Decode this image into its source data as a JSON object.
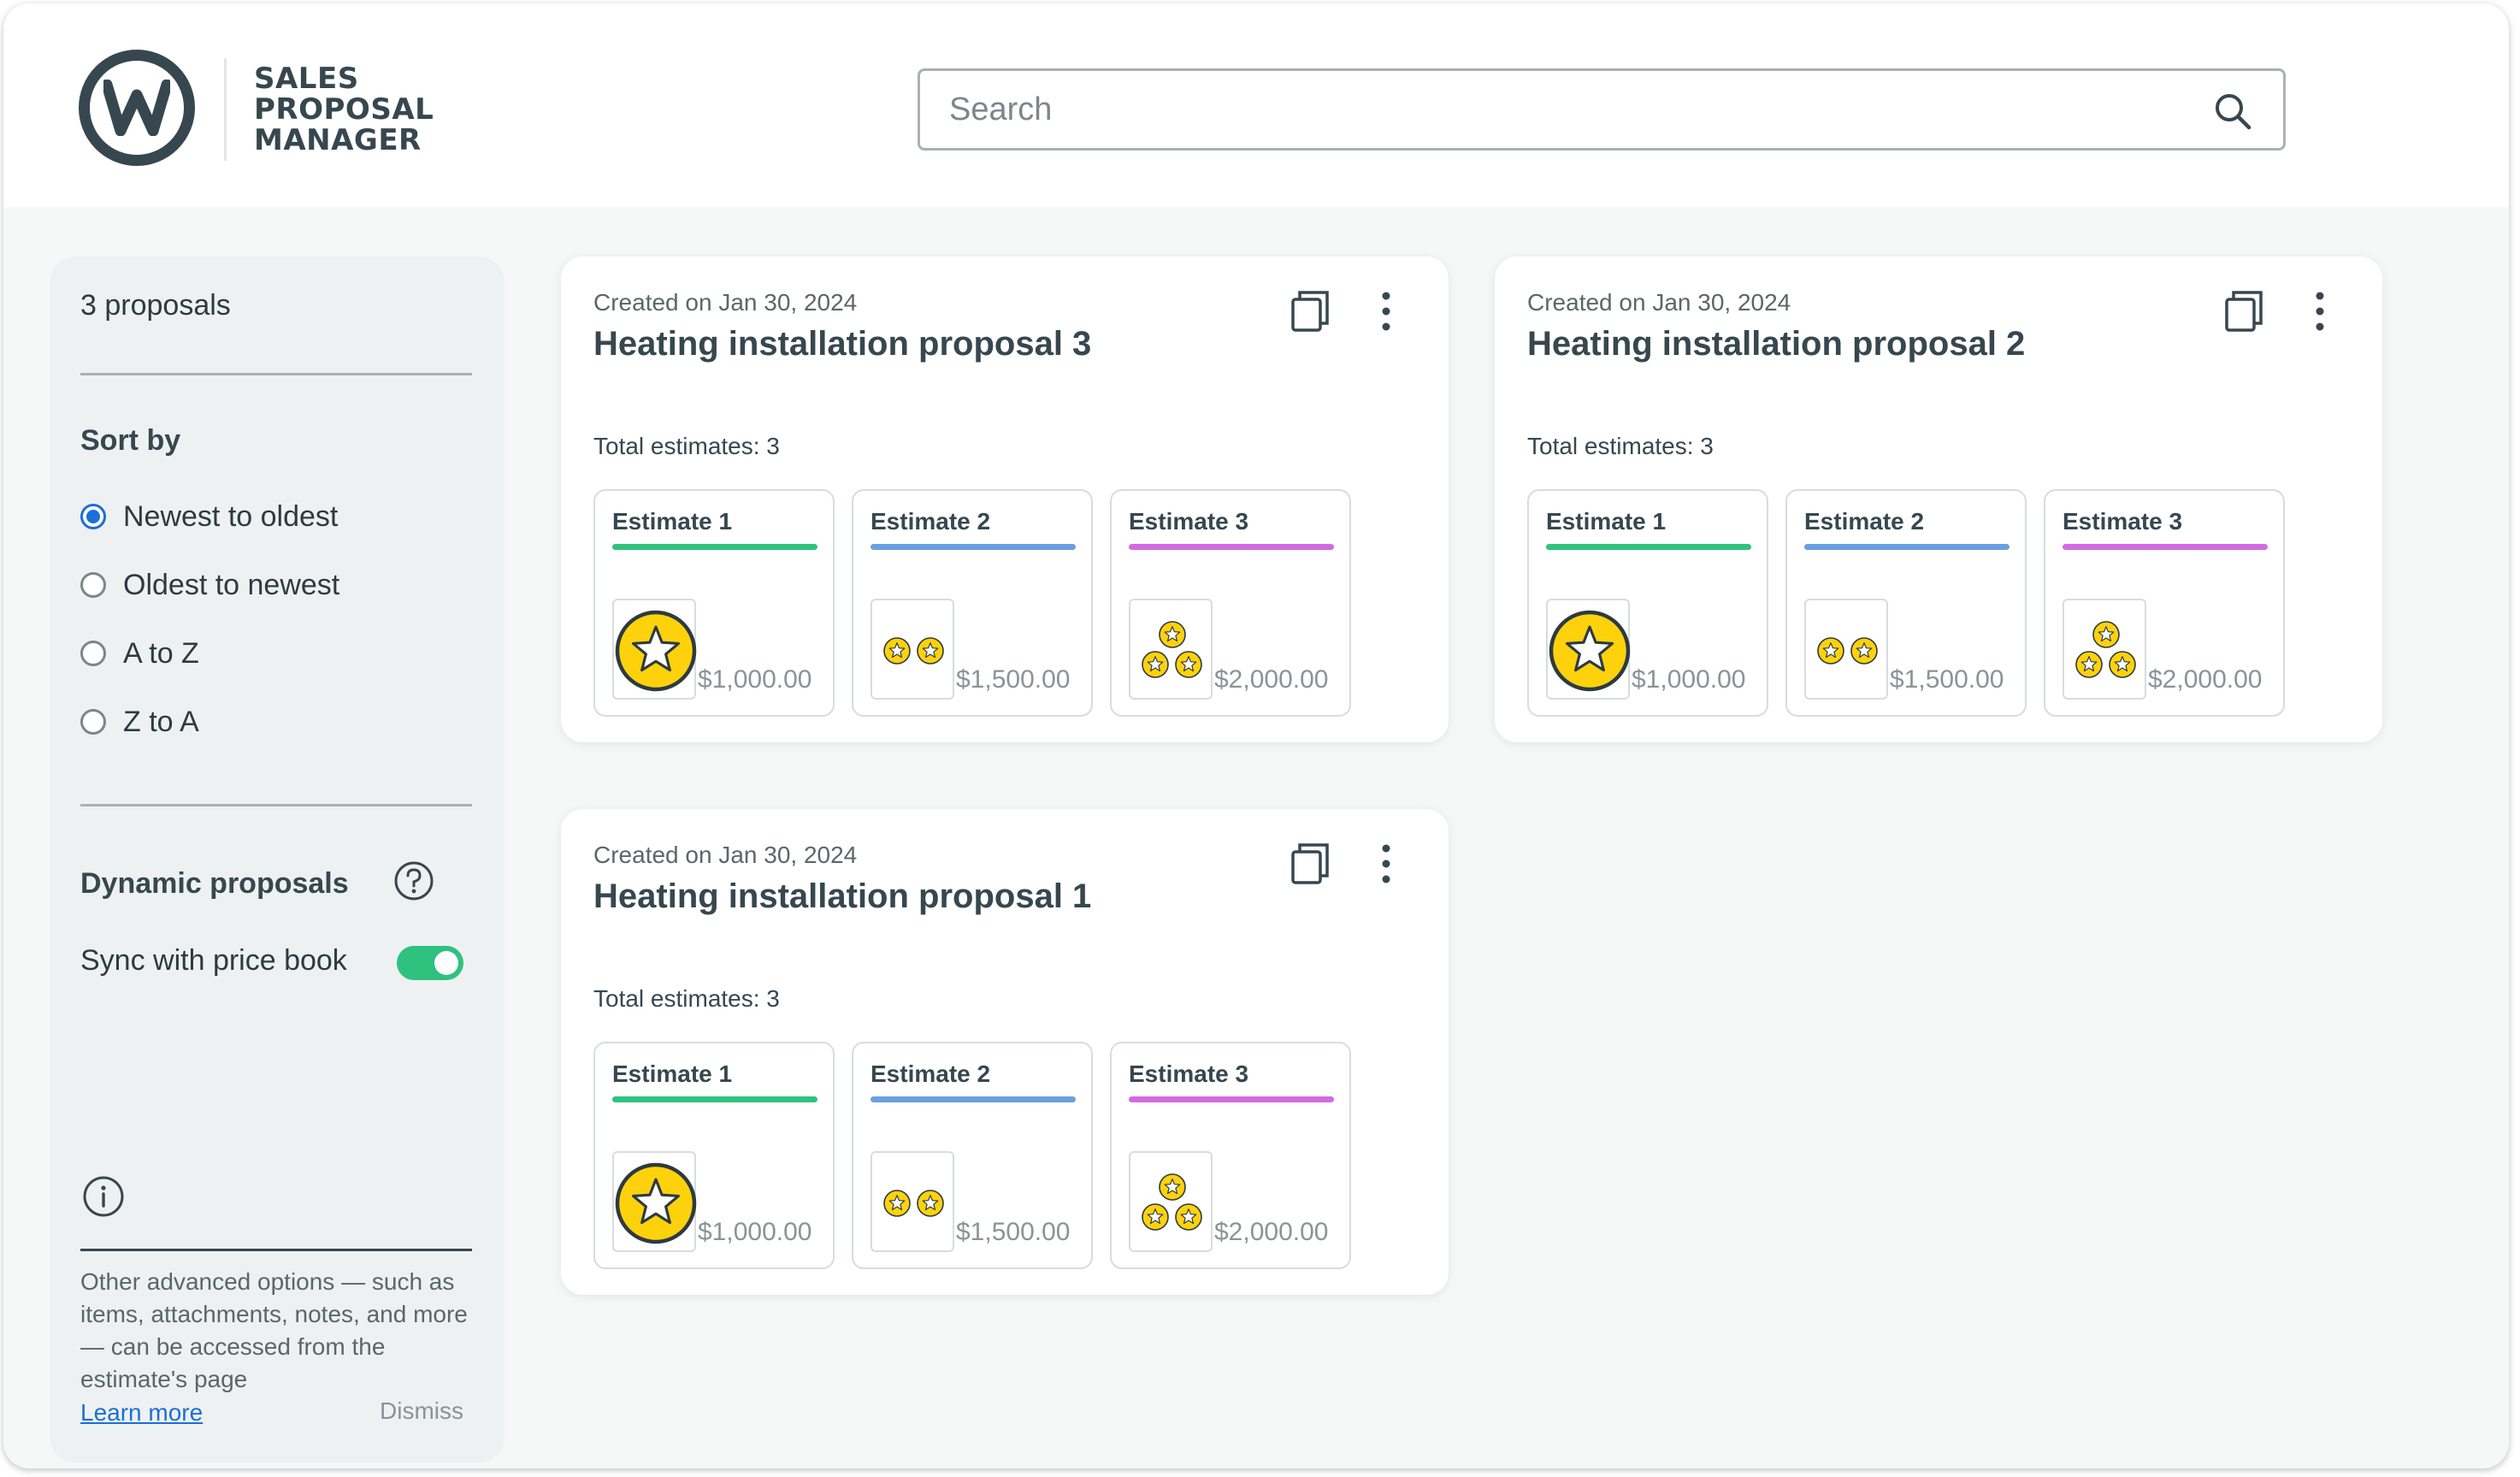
{
  "app": {
    "logo_text": [
      "SALES",
      "PROPOSAL",
      "MANAGER"
    ]
  },
  "search": {
    "placeholder": "Search",
    "value": ""
  },
  "sidebar": {
    "count": "3 proposals",
    "sort_heading": "Sort by",
    "sort_options": [
      {
        "label": "Newest to oldest",
        "checked": true
      },
      {
        "label": "Oldest to newest",
        "checked": false
      },
      {
        "label": "A to Z",
        "checked": false
      },
      {
        "label": "Z to A",
        "checked": false
      }
    ],
    "dynamic_heading": "Dynamic proposals",
    "sync_label": "Sync with price book",
    "sync_enabled": true,
    "note": "Other advanced options — such as items, attachments, notes, and more — can be accessed from the estimate's page",
    "learn_more": "Learn more",
    "dismiss": "Dismiss"
  },
  "proposals": [
    {
      "created": "Created on Jan 30, 2024",
      "title": "Heating installation proposal 3",
      "total": "Total estimates: 3",
      "estimates": [
        {
          "name": "Estimate 1",
          "price": "$1,000.00",
          "color": "#2ec27e",
          "icon": "one-star-coin-icon"
        },
        {
          "name": "Estimate 2",
          "price": "$1,500.00",
          "color": "#6a9fe0",
          "icon": "two-star-coins-icon"
        },
        {
          "name": "Estimate 3",
          "price": "$2,000.00",
          "color": "#d36be0",
          "icon": "three-star-coins-icon"
        }
      ]
    },
    {
      "created": "Created on Jan 30, 2024",
      "title": "Heating installation proposal 2",
      "total": "Total estimates: 3",
      "estimates": [
        {
          "name": "Estimate 1",
          "price": "$1,000.00",
          "color": "#2ec27e",
          "icon": "one-star-coin-icon"
        },
        {
          "name": "Estimate 2",
          "price": "$1,500.00",
          "color": "#6a9fe0",
          "icon": "two-star-coins-icon"
        },
        {
          "name": "Estimate 3",
          "price": "$2,000.00",
          "color": "#d36be0",
          "icon": "three-star-coins-icon"
        }
      ]
    },
    {
      "created": "Created on Jan 30, 2024",
      "title": "Heating installation proposal 1",
      "total": "Total estimates: 3",
      "estimates": [
        {
          "name": "Estimate 1",
          "price": "$1,000.00",
          "color": "#2ec27e",
          "icon": "one-star-coin-icon"
        },
        {
          "name": "Estimate 2",
          "price": "$1,500.00",
          "color": "#6a9fe0",
          "icon": "two-star-coins-icon"
        },
        {
          "name": "Estimate 3",
          "price": "$2,000.00",
          "color": "#d36be0",
          "icon": "three-star-coins-icon"
        }
      ]
    }
  ]
}
